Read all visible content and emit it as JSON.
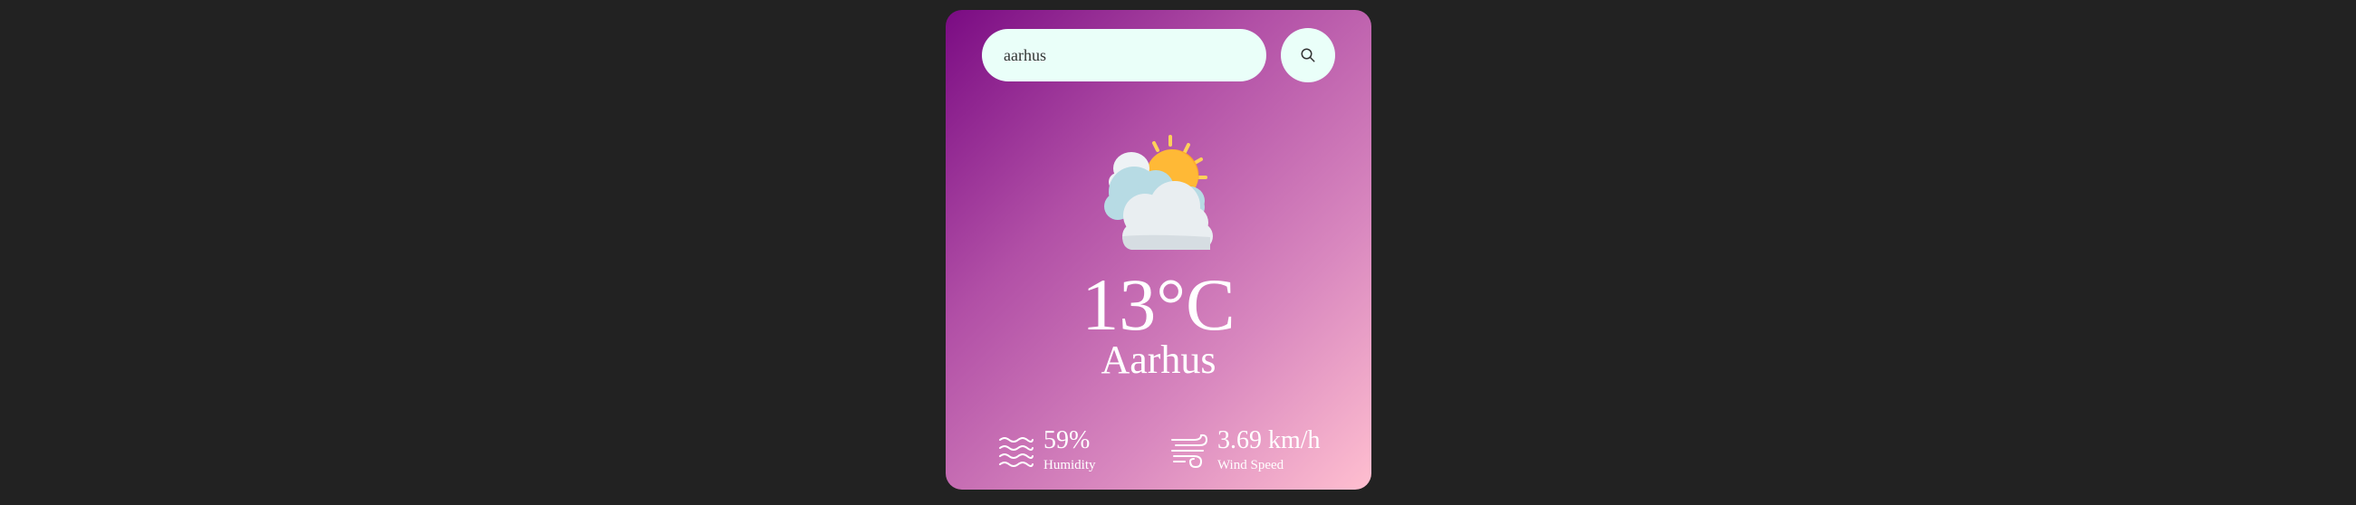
{
  "search": {
    "value": "aarhus",
    "icon": "search-icon"
  },
  "weather": {
    "icon": "partly-cloudy-sun-icon",
    "temperature": "13°C",
    "city": "Aarhus"
  },
  "details": {
    "humidity": {
      "value": "59%",
      "label": "Humidity",
      "icon": "humidity-waves-icon"
    },
    "wind": {
      "value": "3.69 km/h",
      "label": "Wind Speed",
      "icon": "wind-icon"
    }
  },
  "colors": {
    "background": "#222222",
    "gradient_start": "#7a0b83",
    "gradient_end": "#ffbfd0",
    "input_bg": "#eafff9",
    "text": "#ffffff"
  }
}
